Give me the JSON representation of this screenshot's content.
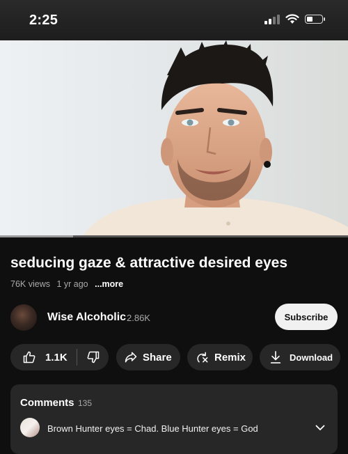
{
  "status_bar": {
    "time": "2:25"
  },
  "video": {
    "progress": 0.21
  },
  "title": "seducing gaze & attractive desired eyes",
  "meta": {
    "views": "76K views",
    "age": "1 yr ago",
    "more": "...more"
  },
  "channel": {
    "name": "Wise Alcoholic",
    "subscribers": "2.86K",
    "subscribe_label": "Subscribe"
  },
  "actions": {
    "likes": "1.1K",
    "share_label": "Share",
    "remix_label": "Remix",
    "download_label": "Download"
  },
  "comments": {
    "title": "Comments",
    "count": "135",
    "top_comment": "Brown Hunter eyes = Chad. Blue Hunter eyes = God"
  },
  "icons": {
    "like": "thumbs-up-icon",
    "dislike": "thumbs-down-icon",
    "share": "share-arrow-icon",
    "remix": "remix-icon",
    "download": "download-icon",
    "chevron": "chevron-down-icon"
  }
}
